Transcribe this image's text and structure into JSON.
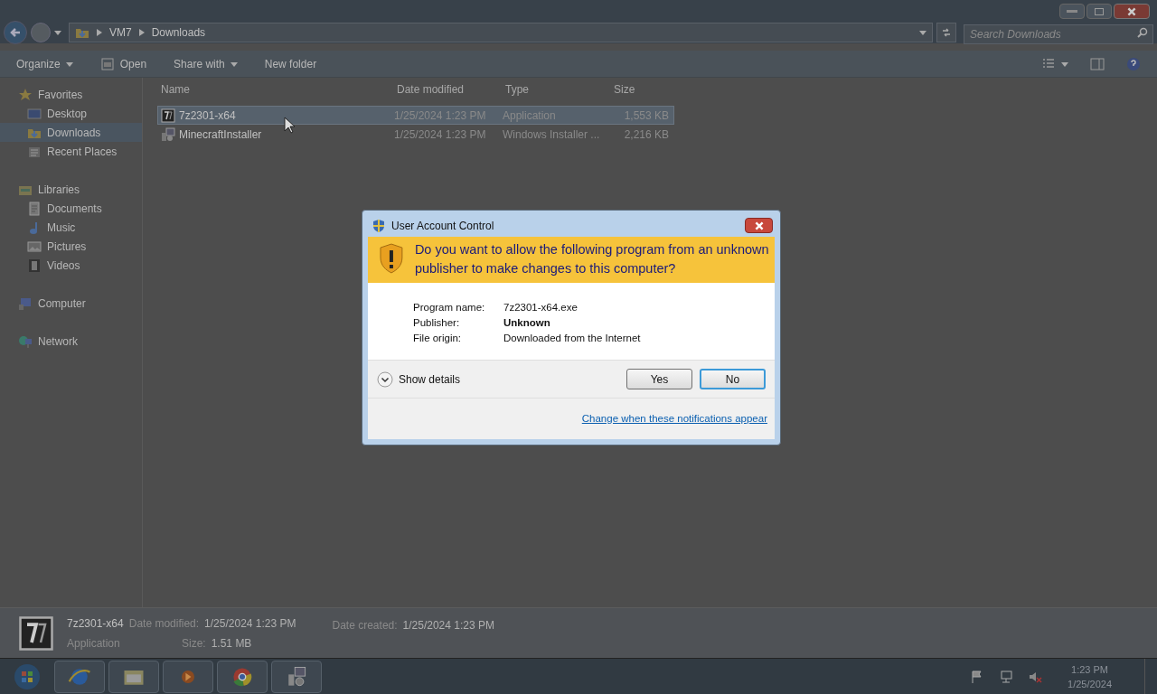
{
  "address_bar": {
    "path": [
      "VM7",
      "Downloads"
    ],
    "search_placeholder": "Search Downloads"
  },
  "toolbar": [
    {
      "label": "Organize",
      "kind": "menu"
    },
    {
      "label": "Open",
      "kind": "open"
    },
    {
      "label": "Share with",
      "kind": "menu"
    },
    {
      "label": "New folder",
      "kind": "plain"
    }
  ],
  "sidebar": [
    {
      "label": "Favorites",
      "kind": "star",
      "selected": false,
      "children": [
        {
          "label": "Desktop",
          "kind": "desktop",
          "selected": false
        },
        {
          "label": "Downloads",
          "kind": "download",
          "selected": true
        },
        {
          "label": "Recent Places",
          "kind": "recent",
          "selected": false
        }
      ]
    },
    {
      "label": "Libraries",
      "kind": "library",
      "selected": false,
      "children": [
        {
          "label": "Documents",
          "kind": "document",
          "selected": false
        },
        {
          "label": "Music",
          "kind": "music",
          "selected": false
        },
        {
          "label": "Pictures",
          "kind": "picture",
          "selected": false
        },
        {
          "label": "Videos",
          "kind": "video",
          "selected": false
        }
      ]
    },
    {
      "label": "Computer",
      "kind": "computer",
      "selected": false
    },
    {
      "label": "Network",
      "kind": "network",
      "selected": false
    }
  ],
  "table": {
    "columns": [
      "Name",
      "Date modified",
      "Type",
      "Size"
    ],
    "rows": [
      {
        "kind": "archive",
        "name": "7z2301-x64",
        "date": "1/25/2024 1:23 PM",
        "type": "Application",
        "size": "1,553 KB",
        "selected": true
      },
      {
        "kind": "installer",
        "name": "MinecraftInstaller",
        "date": "1/25/2024 1:23 PM",
        "type": "Windows Installer ...",
        "size": "2,216 KB",
        "selected": false
      }
    ]
  },
  "details_pane": {
    "name": "7z2301-x64",
    "type": "Application",
    "fields": [
      {
        "label": "Date modified:",
        "value": "1/25/2024 1:23 PM"
      },
      {
        "label": "Size:",
        "value": "1.51 MB"
      },
      {
        "label": "Date created:",
        "value": "1/25/2024 1:23 PM"
      }
    ]
  },
  "dialog": {
    "title": "User Account Control",
    "question": "Do you want to allow the following program from an unknown publisher to make changes to this computer?",
    "fields": [
      {
        "label": "Program name:",
        "value": "7z2301-x64.exe",
        "bold": false
      },
      {
        "label": "Publisher:",
        "value": "Unknown",
        "bold": true
      },
      {
        "label": "File origin:",
        "value": "Downloaded from the Internet",
        "bold": false
      }
    ],
    "details_toggle": "Show details",
    "buttons": [
      {
        "label": "Yes",
        "selected": false
      },
      {
        "label": "No",
        "selected": true
      }
    ],
    "link": "Change when these notifications appear"
  },
  "taskbar": {
    "apps": [
      {
        "kind": "browser"
      },
      {
        "kind": "folder"
      },
      {
        "kind": "media"
      },
      {
        "kind": "chrome"
      },
      {
        "kind": "installer"
      }
    ],
    "time": "1:23 PM",
    "date": "1/25/2024"
  }
}
